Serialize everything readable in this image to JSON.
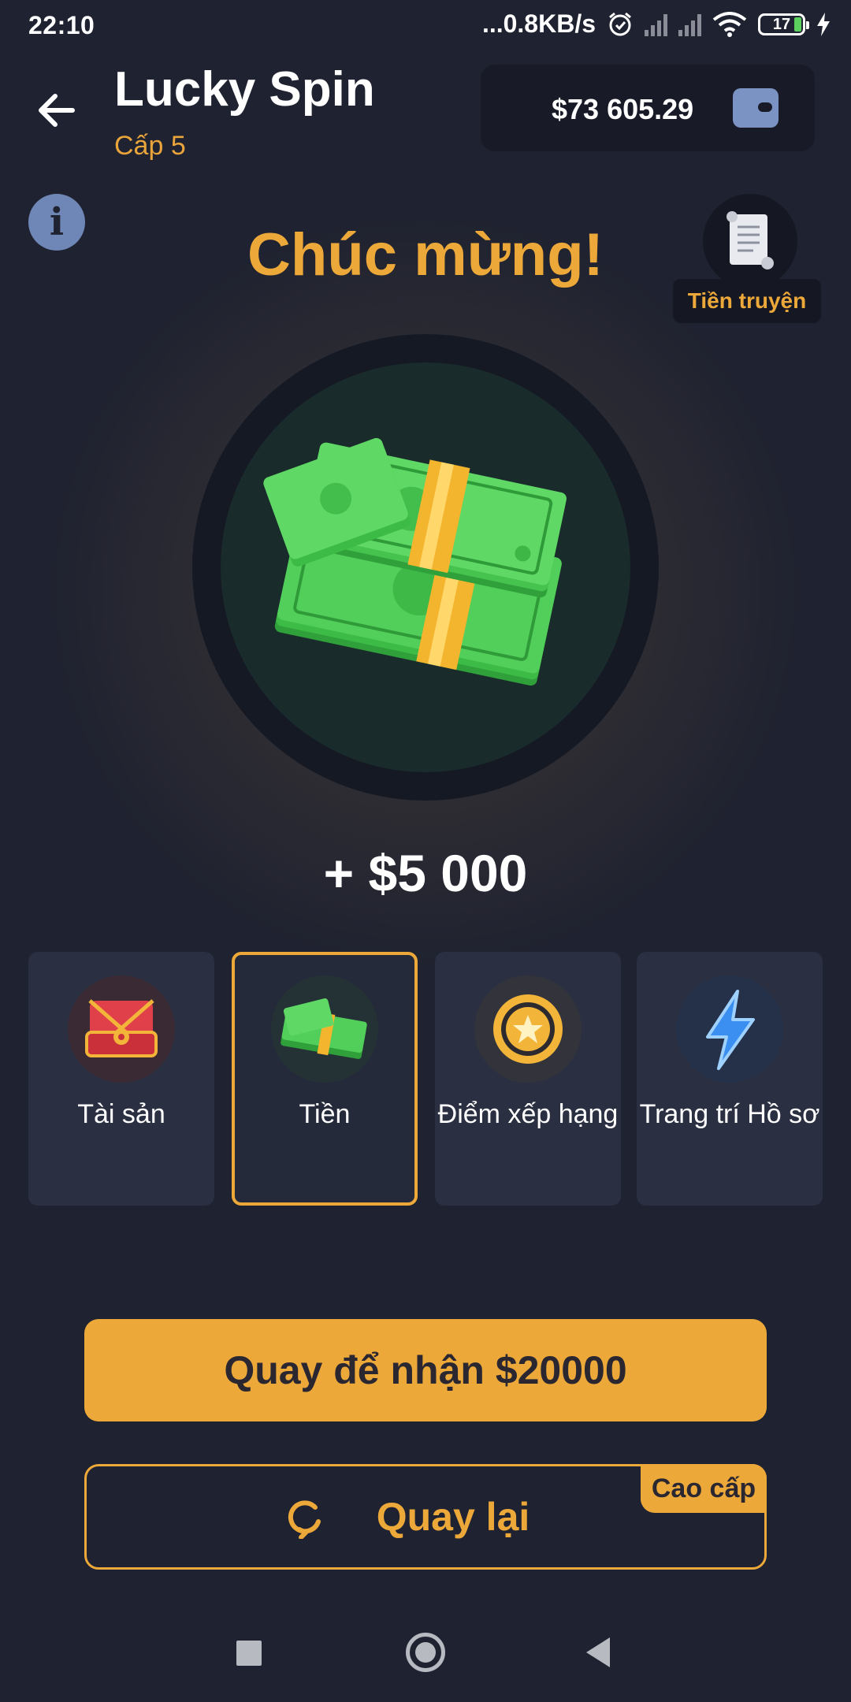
{
  "status_bar": {
    "time": "22:10",
    "network_speed": "...0.8KB/s",
    "battery": "17"
  },
  "header": {
    "title": "Lucky Spin",
    "subtitle": "Cấp 5",
    "balance": "$73 605.29"
  },
  "main": {
    "congrats": "Chúc mừng!",
    "story_label": "Tiền truyện",
    "prize_amount": "+ $5 000"
  },
  "categories": [
    {
      "label": "Tài sản",
      "selected": false
    },
    {
      "label": "Tiền",
      "selected": true
    },
    {
      "label": "Điểm xếp hạng",
      "selected": false
    },
    {
      "label": "Trang trí Hồ sơ",
      "selected": false
    }
  ],
  "actions": {
    "spin_button": "Quay để nhận $20000",
    "respin_button": "Quay lại",
    "premium_badge": "Cao cấp"
  },
  "colors": {
    "accent": "#eda83a",
    "background": "#1f2230",
    "card": "#2a2f42"
  }
}
